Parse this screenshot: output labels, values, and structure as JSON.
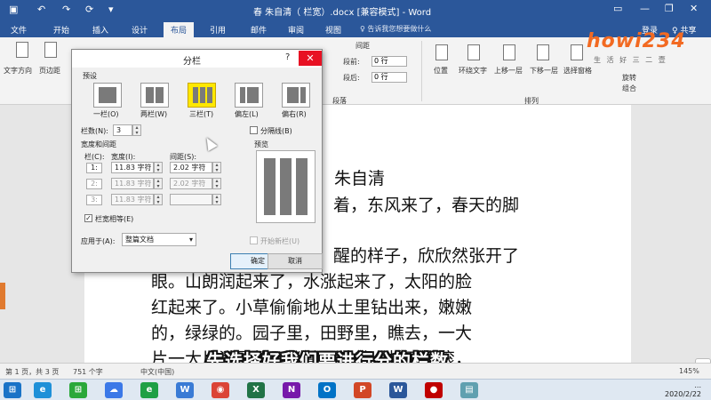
{
  "titlebar": {
    "title": "春 朱自清（ 栏宽）.docx [兼容模式] - Word",
    "bg": "#2b579a"
  },
  "tabs": [
    {
      "label": "文件"
    },
    {
      "label": "开始"
    },
    {
      "label": "插入"
    },
    {
      "label": "设计"
    },
    {
      "label": "布局",
      "active": true
    },
    {
      "label": "引用"
    },
    {
      "label": "邮件"
    },
    {
      "label": "审阅"
    },
    {
      "label": "视图"
    }
  ],
  "tell_me": "♀ 告诉我您想要做什么",
  "login": "登录",
  "share": "♀ 共享",
  "ribbon": {
    "text_direction": "文字方向",
    "margins": "页边距",
    "breaks": "分隔符",
    "indent": "缩进",
    "spacing": "间距",
    "space_before": "段前:",
    "space_before_value": "0 行",
    "space_after": "段后:",
    "space_after_value": "0 行",
    "position": "位置",
    "wrap_text": "环绕文字",
    "bring_forward": "上移一层",
    "send_backward": "下移一层",
    "selection_pane": "选择窗格",
    "group": "组合",
    "rotate": "旋转",
    "group_page_setup": "页面设置",
    "group_paragraph": "段落",
    "group_arrange": "排列"
  },
  "document": {
    "lines": [
      "朱自清",
      "着，东风来了，春天的脚",
      "醒的样子，欣欣然张开了",
      "眼。山朗润起来了，水涨起来了，太阳的脸",
      "红起来了。小草偷偷地从土里钻出来，嫩嫩",
      "的，绿绿的。园子里，田野里，瞧去，一大",
      "片一大片满是的。坐着，躺着，打两个滚，"
    ]
  },
  "subtitle": "先选择好我们要进行分的栏数",
  "watermark": {
    "big": "howi234",
    "small": "生 活 好 三 二 壹"
  },
  "dialog": {
    "title": "分栏",
    "help": "?",
    "close": "✕",
    "presets_label": "预设",
    "presets": [
      {
        "label": "一栏(O)"
      },
      {
        "label": "两栏(W)"
      },
      {
        "label": "三栏(T)",
        "selected": true
      },
      {
        "label": "偏左(L)"
      },
      {
        "label": "偏右(R)"
      }
    ],
    "num_columns_label": "栏数(N):",
    "num_columns_value": "3",
    "line_between_label": "分隔线(B)",
    "width_spacing_label": "宽度和间距",
    "preview_label": "预览",
    "col_header": "栏(C):",
    "width_header": "宽度(I):",
    "spacing_header": "间距(S):",
    "rows": [
      {
        "num": "1:",
        "width": "11.83 字符",
        "spacing": "2.02 字符",
        "enabled": true
      },
      {
        "num": "2:",
        "width": "11.83 字符",
        "spacing": "2.02 字符",
        "enabled": false
      },
      {
        "num": "3:",
        "width": "11.83 字符",
        "spacing": "",
        "enabled": false
      }
    ],
    "equal_width_label": "栏宽相等(E)",
    "equal_width_checked": true,
    "apply_to_label": "应用于(A):",
    "apply_to_value": "整篇文档",
    "new_column_label": "开始新栏(U)",
    "ok": "确定",
    "cancel": "取消",
    "accent": "#ffe800"
  },
  "status": {
    "page": "第 1 页，共 3 页",
    "words": "751 个字",
    "lang": "中文(中国)",
    "zoom": "145%"
  },
  "taskbar": {
    "time": "...",
    "date": "2020/2/22",
    "apps": [
      {
        "name": "ie-icon",
        "label": "e",
        "color": "#1e90d8"
      },
      {
        "name": "store-icon",
        "label": "⊞",
        "color": "#2ba83a"
      },
      {
        "name": "cloud-icon",
        "label": "☁",
        "color": "#3b78e7"
      },
      {
        "name": "ie2-icon",
        "label": "e",
        "color": "#1fa045"
      },
      {
        "name": "wps-icon",
        "label": "W",
        "color": "#3a7bd5"
      },
      {
        "name": "chrome-icon",
        "label": "◉",
        "color": "#db4437"
      },
      {
        "name": "excel-icon",
        "label": "X",
        "color": "#217346"
      },
      {
        "name": "onenote-icon",
        "label": "N",
        "color": "#7719aa"
      },
      {
        "name": "outlook-icon",
        "label": "O",
        "color": "#0072c6"
      },
      {
        "name": "powerpoint-icon",
        "label": "P",
        "color": "#d24726"
      },
      {
        "name": "word-icon",
        "label": "W",
        "color": "#2b579a"
      },
      {
        "name": "record-icon",
        "label": "●",
        "color": "#c00000"
      },
      {
        "name": "tool-icon",
        "label": "▤",
        "color": "#60a0b0"
      }
    ]
  }
}
